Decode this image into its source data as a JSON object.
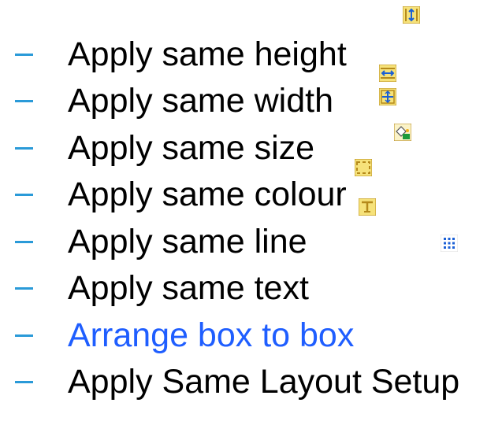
{
  "menu": {
    "items": [
      {
        "label": "Apply same height",
        "icon": "same-height-icon"
      },
      {
        "label": "Apply same width",
        "icon": "same-width-icon"
      },
      {
        "label": "Apply same size",
        "icon": "same-size-icon"
      },
      {
        "label": "Apply same colour",
        "icon": "same-colour-icon"
      },
      {
        "label": "Apply same line",
        "icon": "same-line-icon"
      },
      {
        "label": "Apply same text",
        "icon": "same-text-icon"
      },
      {
        "label": "Arrange box to box",
        "icon": "arrange-box-icon"
      },
      {
        "label": "Apply Same Layout Setup",
        "icon": "layout-setup-icon"
      }
    ]
  },
  "colors": {
    "bullet": "#2a9ad8",
    "text": "#000000",
    "accent_text": "#1f5eff",
    "icon_fill": "#f6e27a",
    "icon_border": "#b58a1b",
    "icon_blue": "#1a5fd6"
  }
}
